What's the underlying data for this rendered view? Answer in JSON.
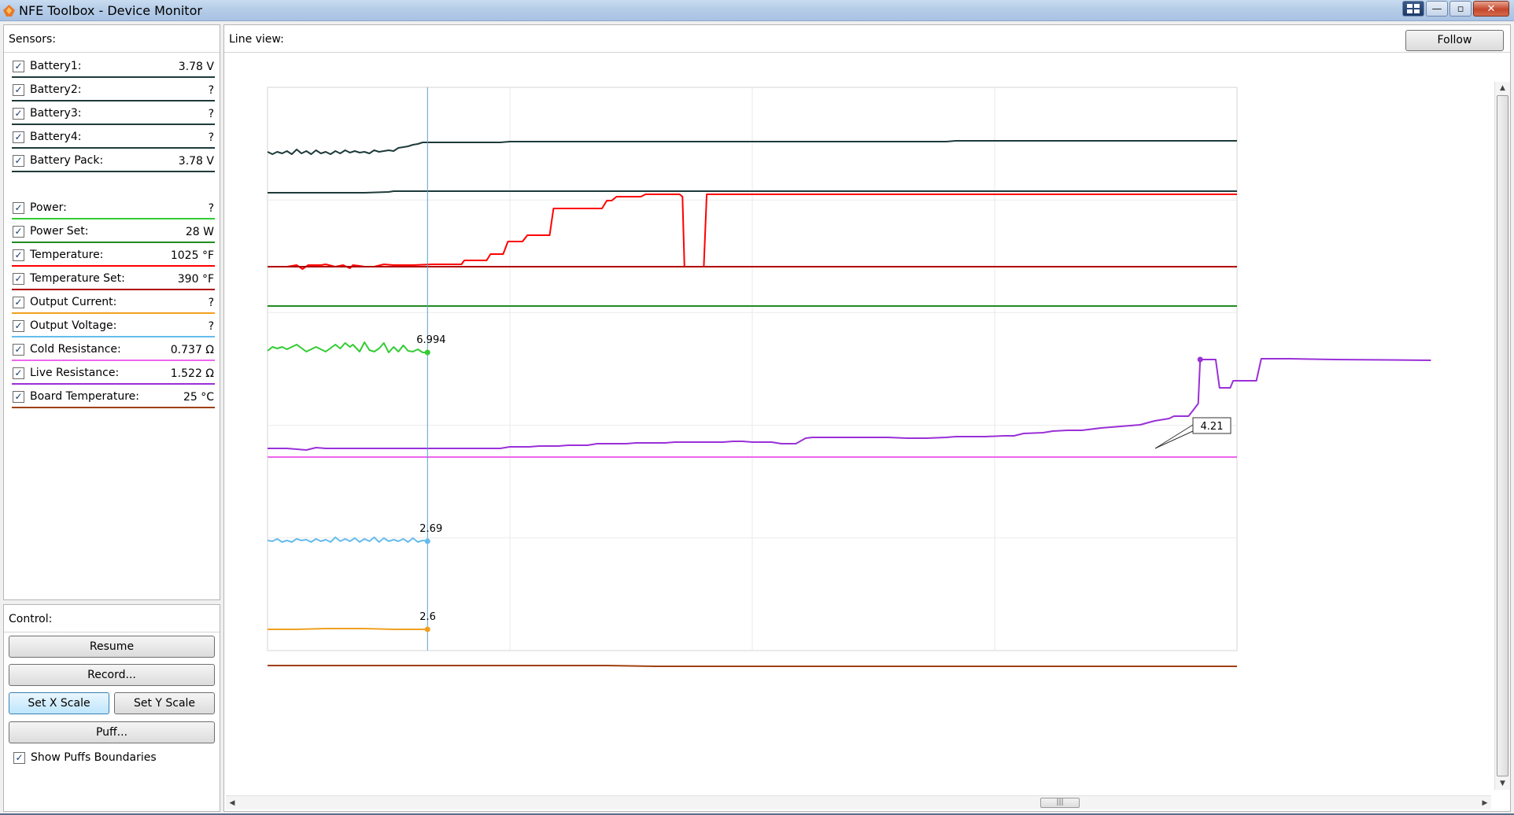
{
  "window": {
    "title": "NFE Toolbox - Device Monitor",
    "buttons": {
      "minimize": "—",
      "maximize": "▫",
      "close": "✕"
    }
  },
  "sensors": {
    "header": "Sensors:",
    "items": [
      {
        "label": "Battery1:",
        "value": "3.78 V",
        "color": "#1f3a3a",
        "checked": "✓"
      },
      {
        "label": "Battery2:",
        "value": "?",
        "color": "#1f3a3a",
        "checked": "✓"
      },
      {
        "label": "Battery3:",
        "value": "?",
        "color": "#1f3a3a",
        "checked": "✓"
      },
      {
        "label": "Battery4:",
        "value": "?",
        "color": "#1f3a3a",
        "checked": "✓"
      },
      {
        "label": "Battery Pack:",
        "value": "3.78 V",
        "color": "#1f3a3a",
        "checked": "✓"
      },
      {
        "label": "Power:",
        "value": "?",
        "color": "#33cc33",
        "checked": "✓"
      },
      {
        "label": "Power Set:",
        "value": "28 W",
        "color": "#228b22",
        "checked": "✓"
      },
      {
        "label": "Temperature:",
        "value": "1025 °F",
        "color": "#ff0000",
        "checked": "✓"
      },
      {
        "label": "Temperature Set:",
        "value": "390 °F",
        "color": "#b00000",
        "checked": "✓"
      },
      {
        "label": "Output Current:",
        "value": "?",
        "color": "#f0a020",
        "checked": "✓"
      },
      {
        "label": "Output Voltage:",
        "value": "?",
        "color": "#66bbee",
        "checked": "✓"
      },
      {
        "label": "Cold Resistance:",
        "value": "0.737 Ω",
        "color": "#ee66ee",
        "checked": "✓"
      },
      {
        "label": "Live Resistance:",
        "value": "1.522 Ω",
        "color": "#9a30d8",
        "checked": "✓"
      },
      {
        "label": "Board Temperature:",
        "value": "25 °C",
        "color": "#a04010",
        "checked": "✓"
      }
    ]
  },
  "control": {
    "header": "Control:",
    "resume": "Resume",
    "record": "Record...",
    "set_x_scale": "Set X Scale",
    "set_y_scale": "Set Y Scale",
    "puff": "Puff...",
    "show_puffs_boundaries": "Show Puffs Boundaries",
    "show_puffs_checked": "✓"
  },
  "line_view": {
    "header": "Line view:",
    "follow": "Follow",
    "cursor_labels": {
      "power": "6.994",
      "output_voltage": "2.69",
      "output_current": "2.6"
    },
    "tooltip": "4.21"
  },
  "chart_data": {
    "type": "line",
    "series": [
      {
        "name": "Battery1:",
        "color": "#1f3a3a",
        "points": [
          [
            0,
            82
          ],
          [
            5,
            85
          ],
          [
            10,
            82
          ],
          [
            15,
            84
          ],
          [
            20,
            81
          ],
          [
            25,
            85
          ],
          [
            30,
            79
          ],
          [
            35,
            84
          ],
          [
            40,
            81
          ],
          [
            45,
            85
          ],
          [
            50,
            80
          ],
          [
            55,
            84
          ],
          [
            60,
            82
          ],
          [
            65,
            85
          ],
          [
            70,
            81
          ],
          [
            75,
            84
          ],
          [
            80,
            80
          ],
          [
            85,
            83
          ],
          [
            90,
            81
          ],
          [
            95,
            83
          ],
          [
            100,
            82
          ],
          [
            105,
            84
          ],
          [
            110,
            80
          ],
          [
            115,
            82
          ],
          [
            120,
            81
          ],
          [
            125,
            80
          ],
          [
            130,
            81
          ],
          [
            135,
            77
          ],
          [
            140,
            76
          ],
          [
            145,
            75
          ],
          [
            150,
            73
          ],
          [
            155,
            72
          ],
          [
            160,
            70
          ],
          [
            165,
            70
          ],
          [
            170,
            70
          ],
          [
            175,
            70
          ],
          [
            180,
            70
          ],
          [
            185,
            70
          ],
          [
            190,
            70
          ],
          [
            195,
            70
          ],
          [
            200,
            70
          ],
          [
            220,
            70
          ],
          [
            240,
            70
          ],
          [
            250,
            69
          ],
          [
            300,
            69
          ],
          [
            400,
            69
          ],
          [
            450,
            69
          ],
          [
            500,
            69
          ],
          [
            540,
            69
          ],
          [
            560,
            69
          ],
          [
            600,
            69
          ],
          [
            650,
            69
          ],
          [
            700,
            69
          ],
          [
            710,
            68
          ],
          [
            1000,
            68
          ]
        ]
      },
      {
        "name": "Battery Pack:",
        "color": "#1f3a3a",
        "points": [
          [
            0,
            134
          ],
          [
            100,
            134
          ],
          [
            125,
            133
          ],
          [
            130,
            132
          ],
          [
            140,
            132
          ],
          [
            1000,
            132
          ]
        ]
      },
      {
        "name": "Temperature:",
        "color": "#ff0000",
        "points": [
          [
            0,
            228
          ],
          [
            20,
            228
          ],
          [
            30,
            226
          ],
          [
            36,
            231
          ],
          [
            42,
            226
          ],
          [
            55,
            226
          ],
          [
            60,
            225
          ],
          [
            70,
            228
          ],
          [
            78,
            226
          ],
          [
            85,
            230
          ],
          [
            88,
            226
          ],
          [
            95,
            227
          ],
          [
            100,
            228
          ],
          [
            110,
            228
          ],
          [
            120,
            225
          ],
          [
            130,
            226
          ],
          [
            140,
            226
          ],
          [
            150,
            226
          ],
          [
            170,
            225
          ],
          [
            200,
            225
          ],
          [
            203,
            220
          ],
          [
            226,
            220
          ],
          [
            230,
            212
          ],
          [
            243,
            212
          ],
          [
            248,
            196
          ],
          [
            263,
            196
          ],
          [
            268,
            188
          ],
          [
            291,
            188
          ],
          [
            295,
            154
          ],
          [
            345,
            154
          ],
          [
            350,
            144
          ],
          [
            355,
            144
          ],
          [
            360,
            139
          ],
          [
            385,
            139
          ],
          [
            390,
            136
          ],
          [
            425,
            136
          ],
          [
            428,
            139
          ],
          [
            430,
            228
          ],
          [
            450,
            228
          ],
          [
            453,
            136
          ],
          [
            1000,
            136
          ]
        ]
      },
      {
        "name": "Temperature Set:",
        "color": "#b00000",
        "points": [
          [
            0,
            228
          ],
          [
            1000,
            228
          ]
        ]
      },
      {
        "name": "Power Set:",
        "color": "#228b22",
        "points": [
          [
            0,
            278
          ],
          [
            1000,
            278
          ]
        ]
      },
      {
        "name": "Power:",
        "color": "#33cc33",
        "points": [
          [
            0,
            335
          ],
          [
            5,
            330
          ],
          [
            10,
            332
          ],
          [
            15,
            330
          ],
          [
            20,
            333
          ],
          [
            30,
            327
          ],
          [
            40,
            336
          ],
          [
            50,
            330
          ],
          [
            60,
            336
          ],
          [
            70,
            327
          ],
          [
            75,
            332
          ],
          [
            80,
            325
          ],
          [
            85,
            330
          ],
          [
            88,
            327
          ],
          [
            95,
            336
          ],
          [
            100,
            324
          ],
          [
            105,
            334
          ],
          [
            110,
            336
          ],
          [
            115,
            332
          ],
          [
            120,
            325
          ],
          [
            125,
            337
          ],
          [
            130,
            330
          ],
          [
            135,
            336
          ],
          [
            140,
            328
          ],
          [
            145,
            335
          ],
          [
            150,
            336
          ],
          [
            155,
            333
          ],
          [
            160,
            337
          ],
          [
            165,
            337
          ]
        ]
      },
      {
        "name": "Live Resistance:",
        "color": "#9a30d8",
        "points": [
          [
            0,
            459
          ],
          [
            20,
            459
          ],
          [
            30,
            460
          ],
          [
            40,
            461
          ],
          [
            50,
            458
          ],
          [
            60,
            459
          ],
          [
            100,
            459
          ],
          [
            200,
            459
          ],
          [
            220,
            459
          ],
          [
            240,
            459
          ],
          [
            250,
            457
          ],
          [
            270,
            457
          ],
          [
            280,
            456
          ],
          [
            300,
            456
          ],
          [
            310,
            455
          ],
          [
            330,
            455
          ],
          [
            340,
            453
          ],
          [
            370,
            453
          ],
          [
            380,
            452
          ],
          [
            410,
            452
          ],
          [
            420,
            451
          ],
          [
            440,
            451
          ],
          [
            460,
            451
          ],
          [
            470,
            451
          ],
          [
            480,
            450
          ],
          [
            490,
            450
          ],
          [
            500,
            451
          ],
          [
            510,
            451
          ],
          [
            520,
            451
          ],
          [
            530,
            453
          ],
          [
            545,
            453
          ],
          [
            555,
            446
          ],
          [
            562,
            445
          ],
          [
            580,
            445
          ],
          [
            600,
            445
          ],
          [
            620,
            445
          ],
          [
            640,
            445
          ],
          [
            660,
            446
          ],
          [
            680,
            446
          ],
          [
            700,
            445
          ],
          [
            710,
            444
          ],
          [
            720,
            444
          ],
          [
            740,
            444
          ],
          [
            760,
            443
          ],
          [
            770,
            443
          ],
          [
            780,
            440
          ],
          [
            800,
            439
          ],
          [
            810,
            437
          ],
          [
            825,
            436
          ],
          [
            840,
            436
          ],
          [
            860,
            433
          ],
          [
            880,
            431
          ],
          [
            900,
            429
          ],
          [
            915,
            424
          ],
          [
            930,
            421
          ],
          [
            935,
            418
          ],
          [
            950,
            418
          ],
          [
            955,
            410
          ],
          [
            960,
            402
          ],
          [
            962,
            346
          ],
          [
            970,
            346
          ],
          [
            978,
            346
          ],
          [
            982,
            382
          ],
          [
            993,
            382
          ],
          [
            996,
            373
          ],
          [
            1005,
            373
          ],
          [
            1020,
            373
          ],
          [
            1025,
            345
          ],
          [
            1055,
            345
          ],
          [
            1100,
            346
          ],
          [
            1200,
            347
          ]
        ]
      },
      {
        "name": "Cold Resistance:",
        "color": "#ee66ee",
        "points": [
          [
            0,
            470
          ],
          [
            1000,
            470
          ]
        ]
      },
      {
        "name": "Output Voltage:",
        "color": "#66bbee",
        "points": [
          [
            0,
            576
          ],
          [
            5,
            577
          ],
          [
            10,
            574
          ],
          [
            15,
            578
          ],
          [
            20,
            576
          ],
          [
            25,
            578
          ],
          [
            30,
            574
          ],
          [
            35,
            576
          ],
          [
            40,
            575
          ],
          [
            45,
            578
          ],
          [
            50,
            574
          ],
          [
            55,
            577
          ],
          [
            60,
            575
          ],
          [
            65,
            578
          ],
          [
            70,
            572
          ],
          [
            75,
            577
          ],
          [
            80,
            574
          ],
          [
            85,
            577
          ],
          [
            90,
            573
          ],
          [
            95,
            578
          ],
          [
            100,
            574
          ],
          [
            105,
            577
          ],
          [
            110,
            572
          ],
          [
            115,
            578
          ],
          [
            120,
            573
          ],
          [
            125,
            577
          ],
          [
            130,
            575
          ],
          [
            135,
            577
          ],
          [
            140,
            574
          ],
          [
            145,
            578
          ],
          [
            150,
            573
          ],
          [
            155,
            578
          ],
          [
            160,
            576
          ],
          [
            165,
            577
          ]
        ]
      },
      {
        "name": "Output Current:",
        "color": "#f0a020",
        "points": [
          [
            0,
            689
          ],
          [
            30,
            689
          ],
          [
            60,
            688
          ],
          [
            100,
            688
          ],
          [
            130,
            689
          ],
          [
            165,
            689
          ]
        ]
      },
      {
        "name": "Board Temperature:",
        "color": "#a04010",
        "points": [
          [
            0,
            735
          ],
          [
            300,
            735
          ],
          [
            350,
            735
          ],
          [
            400,
            736
          ],
          [
            1000,
            736
          ]
        ]
      }
    ]
  }
}
